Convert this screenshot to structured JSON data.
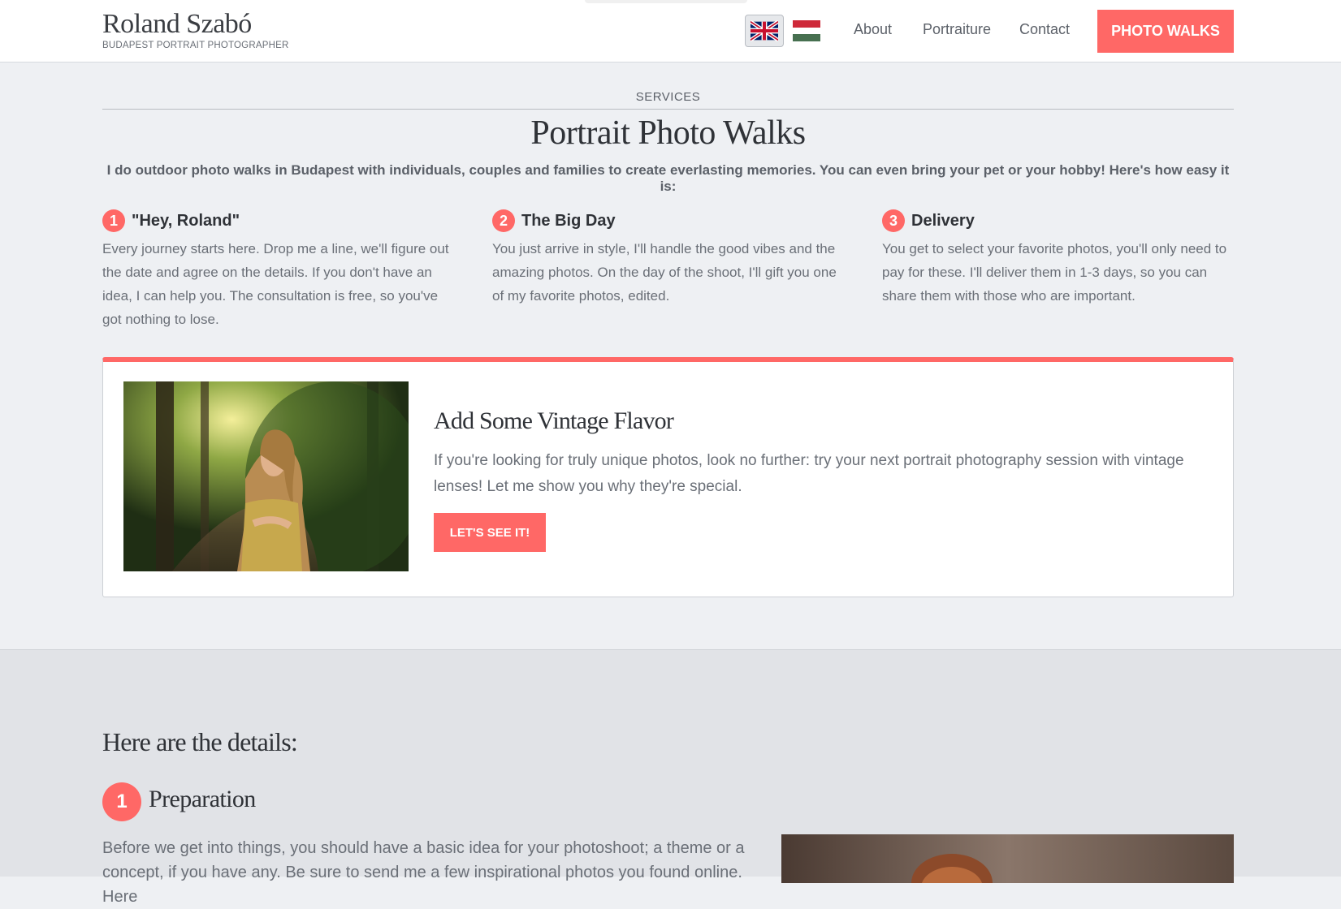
{
  "header": {
    "brand_name": "Roland Szabó",
    "brand_tagline": "BUDAPEST PORTRAIT PHOTOGRAPHER",
    "languages": [
      {
        "name": "English",
        "icon": "uk-flag-icon",
        "active": true
      },
      {
        "name": "Hungarian",
        "icon": "hungary-flag-icon",
        "active": false
      }
    ],
    "nav": [
      {
        "label": "About"
      },
      {
        "label": "Portraiture"
      },
      {
        "label": "Contact"
      }
    ],
    "cta_label": "PHOTO WALKS"
  },
  "services": {
    "eyebrow": "SERVICES",
    "title": "Portrait Photo Walks",
    "intro": "I do outdoor photo walks in Budapest with individuals, couples and families to create everlasting memories. You can even bring your pet or your hobby! Here's how easy it is:",
    "steps": [
      {
        "number": "1",
        "title": "\"Hey, Roland\"",
        "text": "Every journey starts here. Drop me a line, we'll figure out the date and agree on the details. If you don't have an idea, I can help you. The consultation is free, so you've got nothing to lose."
      },
      {
        "number": "2",
        "title": "The Big Day",
        "text": "You just arrive in style, I'll handle the good vibes and the amazing photos. On the day of the shoot, I'll gift you one of my favorite photos, edited."
      },
      {
        "number": "3",
        "title": "Delivery",
        "text": "You get to select your favorite photos, you'll only need to pay for these. I'll deliver them in 1-3 days, so you can share them with those who are important."
      }
    ]
  },
  "vintage_card": {
    "title": "Add Some Vintage Flavor",
    "text": "If you're looking for truly unique photos, look no further: try your next portrait photography session with vintage lenses! Let me show you why they're special.",
    "button_label": "LET'S SEE IT!"
  },
  "details": {
    "title": "Here are the details:",
    "preparation": {
      "number": "1",
      "title": "Preparation",
      "text": "Before we get into things, you should have a basic idea for your photoshoot; a theme or a concept, if you have any. Be sure to send me a few inspirational photos you found online. Here"
    }
  },
  "colors": {
    "accent": "#ff6866",
    "page_bg": "#eef0f3",
    "details_bg": "#e1e3e7",
    "heading": "#2f3237",
    "body_text": "#6a6f77"
  }
}
